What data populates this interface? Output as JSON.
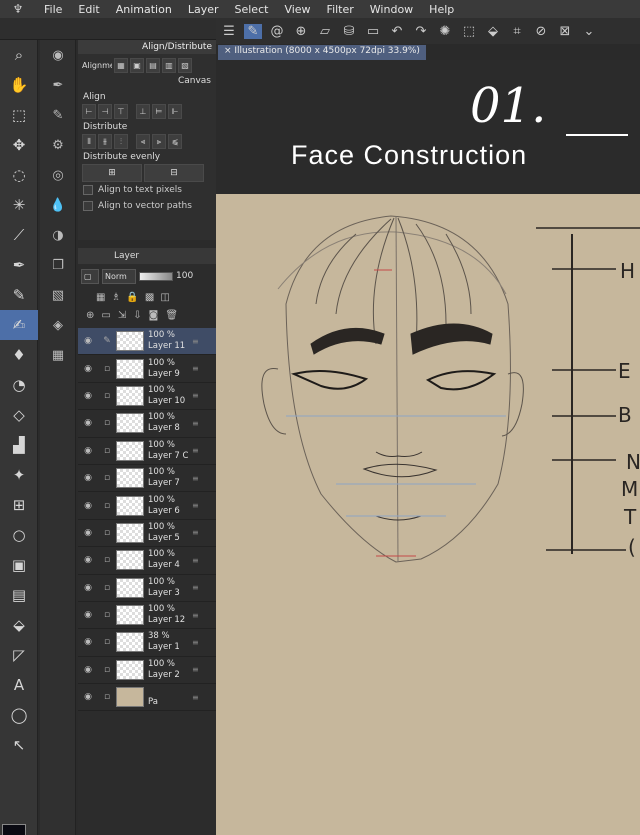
{
  "menubar": {
    "items": [
      "File",
      "Edit",
      "Animation",
      "Layer",
      "Select",
      "View",
      "Filter",
      "Window",
      "Help"
    ]
  },
  "align_panel": {
    "title": "Align/Distribute",
    "alignment_label": "Alignment",
    "canvas_label": "Canvas",
    "align_label": "Align",
    "distribute_label": "Distribute",
    "distribute_evenly_label": "Distribute evenly",
    "align_text_pixels": "Align to text pixels",
    "align_vector_paths": "Align to vector paths"
  },
  "layer_panel": {
    "title": "Layer",
    "blend_mode": "Norm",
    "opacity": "100",
    "layers": [
      {
        "opacity": "100 %",
        "name": "Layer 11",
        "active": true
      },
      {
        "opacity": "100 %",
        "name": "Layer 9"
      },
      {
        "opacity": "100 %",
        "name": "Layer 10"
      },
      {
        "opacity": "100 %",
        "name": "Layer 8"
      },
      {
        "opacity": "100 %",
        "name": "Layer 7 C"
      },
      {
        "opacity": "100 %",
        "name": "Layer 7"
      },
      {
        "opacity": "100 %",
        "name": "Layer 6"
      },
      {
        "opacity": "100 %",
        "name": "Layer 5"
      },
      {
        "opacity": "100 %",
        "name": "Layer 4"
      },
      {
        "opacity": "100 %",
        "name": "Layer 3"
      },
      {
        "opacity": "100 %",
        "name": "Layer 12"
      },
      {
        "opacity": "38 %",
        "name": "Layer 1"
      },
      {
        "opacity": "100 %",
        "name": "Layer 2"
      },
      {
        "opacity": "",
        "name": "Pa",
        "paper": true
      }
    ]
  },
  "document": {
    "tab_label": "Illustration (8000 x 4500px 72dpi 33.9%)"
  },
  "canvas": {
    "number": "01.",
    "title": "Face Construction",
    "ruler_labels": [
      "H",
      "E",
      "B",
      "N",
      "M",
      "T",
      "("
    ]
  },
  "colors": {
    "accent": "#4d6fa8",
    "paper": "#c6b79c",
    "ui_dark": "#2b2b2b"
  }
}
